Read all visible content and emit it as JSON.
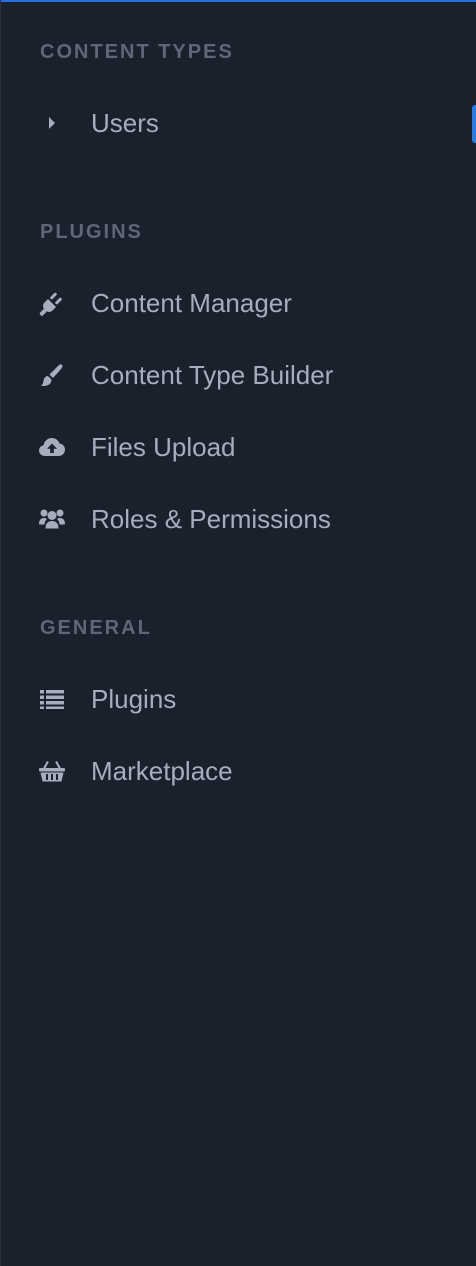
{
  "sections": {
    "content_types": {
      "title": "CONTENT TYPES",
      "items": [
        {
          "label": "Users",
          "icon": "caret-right-icon"
        }
      ]
    },
    "plugins": {
      "title": "PLUGINS",
      "items": [
        {
          "label": "Content Manager",
          "icon": "plug-icon"
        },
        {
          "label": "Content Type Builder",
          "icon": "paint-brush-icon"
        },
        {
          "label": "Files Upload",
          "icon": "cloud-upload-icon"
        },
        {
          "label": "Roles & Permissions",
          "icon": "users-icon"
        }
      ]
    },
    "general": {
      "title": "GENERAL",
      "items": [
        {
          "label": "Plugins",
          "icon": "list-icon"
        },
        {
          "label": "Marketplace",
          "icon": "shopping-basket-icon"
        }
      ]
    }
  },
  "colors": {
    "background": "#1b202d",
    "section_title": "#5f6677",
    "item_text": "#a6adbc",
    "icon": "#a6adbc",
    "accent": "#2a7ce0"
  }
}
